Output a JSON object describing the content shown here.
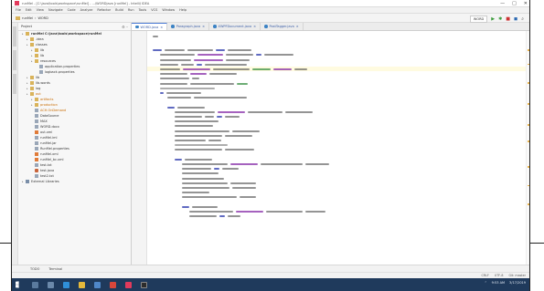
{
  "window": {
    "title": "runMel - [C:\\java\\tools\\workspace\\runMel] - ...\\WORDjava [runMel] - IntelliJ IDEA",
    "controls": [
      "—",
      "□",
      "✕"
    ]
  },
  "menu": [
    "File",
    "Edit",
    "View",
    "Navigate",
    "Code",
    "Analyze",
    "Refactor",
    "Build",
    "Run",
    "Tools",
    "VCS",
    "Window",
    "Help"
  ],
  "breadcrumb": [
    "runMel",
    "WORD"
  ],
  "run_tools": {
    "config": "WORD",
    "icons": [
      "run-icon",
      "debug-icon",
      "stop-icon",
      "build-icon",
      "search-icon"
    ]
  },
  "project": {
    "header": "Project",
    "tree": [
      {
        "label": "runMel C:\\java\\tools\\workspace\\runMel",
        "icon": "folder",
        "indent": 0,
        "bold": true
      },
      {
        "label": ".idea",
        "icon": "folder",
        "indent": 1
      },
      {
        "label": "classes",
        "icon": "folder",
        "indent": 1
      },
      {
        "label": "lib",
        "icon": "folder",
        "indent": 2
      },
      {
        "label": "lib",
        "icon": "folder",
        "indent": 2
      },
      {
        "label": "resources",
        "icon": "folder",
        "indent": 2
      },
      {
        "label": "application.properties",
        "icon": "file",
        "indent": 3
      },
      {
        "label": "logback.properties",
        "icon": "file",
        "indent": 3
      },
      {
        "label": "lib",
        "icon": "folder",
        "indent": 1
      },
      {
        "label": "lib-words",
        "icon": "folder",
        "indent": 1
      },
      {
        "label": "log",
        "icon": "folder",
        "indent": 1
      },
      {
        "label": "out",
        "icon": "folder",
        "indent": 1,
        "orange": true
      },
      {
        "label": "artifacts",
        "icon": "folder",
        "indent": 2,
        "orange": true
      },
      {
        "label": "production",
        "icon": "folder",
        "indent": 2,
        "orange": true
      },
      {
        "label": "ACH.OnDemand",
        "icon": "file",
        "indent": 2,
        "orange": true
      },
      {
        "label": "DataSource",
        "icon": "file",
        "indent": 2
      },
      {
        "label": "MAX",
        "icon": "file",
        "indent": 2
      },
      {
        "label": "WORD.docx",
        "icon": "file",
        "indent": 2
      },
      {
        "label": "out.xml",
        "icon": "xml",
        "indent": 2
      },
      {
        "label": "runMel.iml",
        "icon": "file",
        "indent": 2
      },
      {
        "label": "runMel.jar",
        "icon": "file",
        "indent": 2
      },
      {
        "label": "RunMel.properties",
        "icon": "file",
        "indent": 2
      },
      {
        "label": "runMel.xml",
        "icon": "xml",
        "indent": 2
      },
      {
        "label": "runMel_bc.xml",
        "icon": "xml",
        "indent": 2
      },
      {
        "label": "test.txt",
        "icon": "file",
        "indent": 2
      },
      {
        "label": "test.java",
        "icon": "java",
        "indent": 2
      },
      {
        "label": "test2.txt",
        "icon": "file",
        "indent": 2
      },
      {
        "label": "External Libraries",
        "icon": "lib",
        "indent": 0
      }
    ]
  },
  "tabs": [
    {
      "label": "WORD.java",
      "active": true
    },
    {
      "label": "Paragraph.java",
      "active": false
    },
    {
      "label": "XWPFDocument.java",
      "active": false
    },
    {
      "label": "PostTagger.java",
      "active": false
    }
  ],
  "bottom_tools": [
    "TODO",
    "Terminal"
  ],
  "status": [
    "CRLF",
    "UTF-8",
    "Git: master"
  ],
  "tray": {
    "time": "9:53 AM",
    "date": "3/17/2019"
  },
  "colors": {
    "keyword": "#1c2ba6",
    "string": "#2f8a3a",
    "field": "#7f1fa3",
    "comment": "#8a8a8a",
    "plain": "#3c3c3c",
    "highlight": "#fffbe0",
    "selection": "#2f65ca"
  },
  "code_lines": [
    {
      "indent": 0,
      "tokens": [
        [
          "plain",
          6
        ]
      ]
    },
    {
      "indent": 0,
      "tokens": []
    },
    {
      "indent": 0,
      "tokens": []
    },
    {
      "indent": 0,
      "tokens": [
        [
          "keyword",
          10
        ],
        [
          "plain",
          22
        ],
        [
          "plain",
          28
        ],
        [
          "keyword",
          10
        ],
        [
          "plain",
          26
        ]
      ]
    },
    {
      "indent": 1,
      "tokens": [
        [
          "plain",
          38
        ],
        [
          "field",
          28
        ],
        [
          "plain",
          30
        ],
        [
          "keyword",
          6
        ],
        [
          "plain",
          32
        ]
      ]
    },
    {
      "indent": 1,
      "tokens": [
        [
          "plain",
          34
        ],
        [
          "field",
          32
        ],
        [
          "plain",
          26
        ]
      ]
    },
    {
      "indent": 1,
      "tokens": [
        [
          "plain",
          20
        ],
        [
          "plain",
          14
        ],
        [
          "keyword",
          6
        ],
        [
          "plain",
          46
        ]
      ]
    },
    {
      "indent": 1,
      "tokens": [
        [
          "plain",
          22
        ],
        [
          "field",
          30
        ],
        [
          "plain",
          40
        ],
        [
          "string",
          20
        ],
        [
          "field",
          20
        ],
        [
          "plain",
          14
        ]
      ],
      "hl": true
    },
    {
      "indent": 1,
      "tokens": [
        [
          "plain",
          30
        ],
        [
          "field",
          18
        ],
        [
          "plain",
          30
        ]
      ]
    },
    {
      "indent": 1,
      "tokens": [
        [
          "plain",
          32
        ],
        [
          "plain",
          8
        ]
      ]
    },
    {
      "indent": 1,
      "tokens": [
        [
          "plain",
          30
        ],
        [
          "plain",
          48
        ],
        [
          "string",
          12
        ]
      ]
    },
    {
      "indent": 1,
      "tokens": [
        [
          "comment",
          60
        ]
      ]
    },
    {
      "indent": 1,
      "tokens": [
        [
          "keyword",
          4
        ],
        [
          "plain",
          38
        ]
      ]
    },
    {
      "indent": 2,
      "tokens": [
        [
          "plain",
          26
        ],
        [
          "plain",
          58
        ]
      ]
    },
    {
      "indent": 0,
      "tokens": []
    },
    {
      "indent": 2,
      "tokens": [
        [
          "keyword",
          8
        ],
        [
          "plain",
          30
        ]
      ]
    },
    {
      "indent": 3,
      "tokens": [
        [
          "plain",
          44
        ],
        [
          "field",
          30
        ],
        [
          "plain",
          38
        ],
        [
          "plain",
          30
        ]
      ]
    },
    {
      "indent": 3,
      "tokens": [
        [
          "plain",
          30
        ],
        [
          "plain",
          10
        ],
        [
          "keyword",
          6
        ],
        [
          "plain",
          16
        ]
      ]
    },
    {
      "indent": 3,
      "tokens": [
        [
          "plain",
          48
        ]
      ]
    },
    {
      "indent": 3,
      "tokens": [
        [
          "plain",
          42
        ]
      ]
    },
    {
      "indent": 3,
      "tokens": [
        [
          "plain",
          60
        ],
        [
          "plain",
          30
        ]
      ]
    },
    {
      "indent": 3,
      "tokens": [
        [
          "plain",
          52
        ],
        [
          "plain",
          30
        ]
      ]
    },
    {
      "indent": 3,
      "tokens": [
        [
          "plain",
          34
        ],
        [
          "plain",
          14
        ]
      ]
    },
    {
      "indent": 3,
      "tokens": [
        [
          "comment",
          58
        ]
      ]
    },
    {
      "indent": 3,
      "tokens": [
        [
          "plain",
          52
        ],
        [
          "plain",
          32
        ]
      ]
    },
    {
      "indent": 0,
      "tokens": []
    },
    {
      "indent": 3,
      "tokens": [
        [
          "keyword",
          8
        ],
        [
          "plain",
          30
        ]
      ]
    },
    {
      "indent": 4,
      "tokens": [
        [
          "plain",
          50
        ],
        [
          "field",
          30
        ],
        [
          "plain",
          46
        ],
        [
          "plain",
          26
        ]
      ]
    },
    {
      "indent": 4,
      "tokens": [
        [
          "plain",
          32
        ],
        [
          "keyword",
          6
        ],
        [
          "plain",
          18
        ]
      ]
    },
    {
      "indent": 4,
      "tokens": [
        [
          "plain",
          40
        ]
      ]
    },
    {
      "indent": 4,
      "tokens": [
        [
          "plain",
          46
        ]
      ]
    },
    {
      "indent": 4,
      "tokens": [
        [
          "plain",
          50
        ],
        [
          "plain",
          28
        ]
      ]
    },
    {
      "indent": 4,
      "tokens": [
        [
          "plain",
          52
        ],
        [
          "plain",
          26
        ]
      ]
    },
    {
      "indent": 4,
      "tokens": [
        [
          "plain",
          30
        ]
      ]
    },
    {
      "indent": 4,
      "tokens": [
        [
          "plain",
          60
        ],
        [
          "plain",
          18
        ]
      ]
    },
    {
      "indent": 0,
      "tokens": []
    },
    {
      "indent": 4,
      "tokens": [
        [
          "keyword",
          8
        ],
        [
          "plain",
          28
        ]
      ]
    },
    {
      "indent": 5,
      "tokens": [
        [
          "plain",
          48
        ],
        [
          "field",
          30
        ],
        [
          "plain",
          40
        ],
        [
          "plain",
          22
        ]
      ]
    },
    {
      "indent": 5,
      "tokens": [
        [
          "plain",
          30
        ],
        [
          "keyword",
          6
        ],
        [
          "plain",
          14
        ]
      ]
    }
  ],
  "scroll_marks": [
    0.08,
    0.14,
    0.22,
    0.31,
    0.4,
    0.47,
    0.58,
    0.66,
    0.74
  ]
}
